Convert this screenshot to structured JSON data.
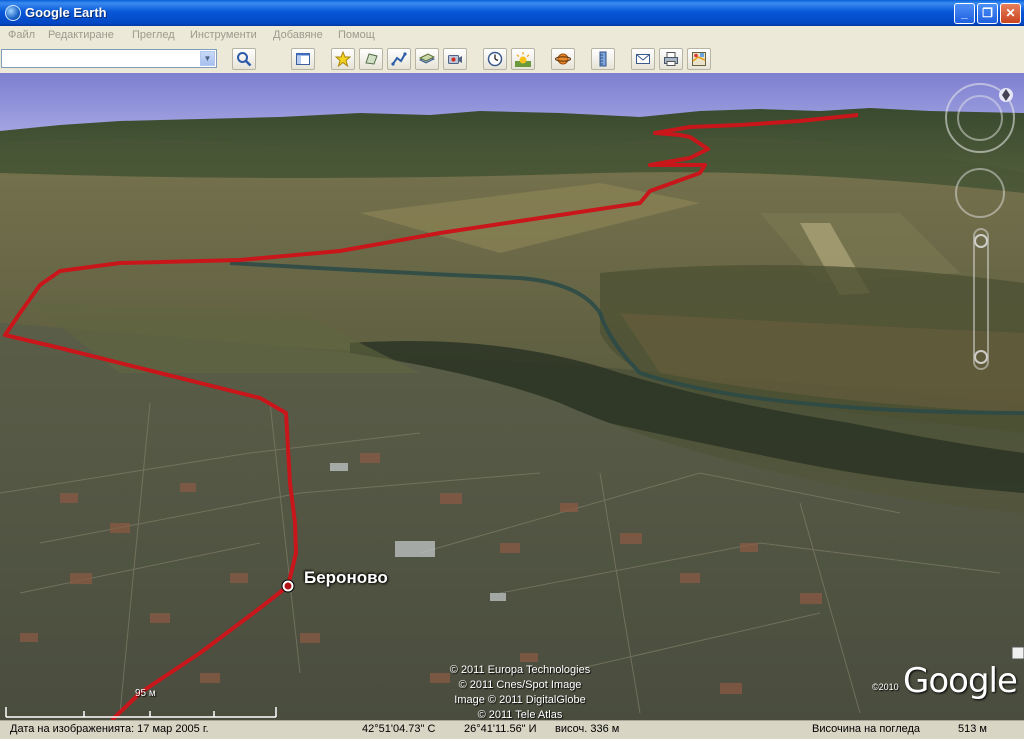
{
  "window": {
    "title": "Google Earth"
  },
  "menu": [
    "Файл",
    "Редактиране",
    "Преглед",
    "Инструменти",
    "Добавяне",
    "Помощ"
  ],
  "search": {
    "value": "",
    "placeholder": ""
  },
  "map": {
    "place_label": "Бероново",
    "attribution": [
      "© 2011 Europa Technologies",
      "© 2011 Cnes/Spot Image",
      "Image © 2011 DigitalGlobe",
      "© 2011 Tele Atlas"
    ],
    "scale_label": "95 м",
    "logo_year": "©2010",
    "logo_text": "Google"
  },
  "status": {
    "image_date": "Дата на изображенията: 17 мар 2005 г.",
    "latitude": "42°51'04.73\" С",
    "longitude": "26°41'11.56\" И",
    "elevation": "височ.  336 м",
    "eye_alt_label": "Височина на погледа",
    "eye_alt_value": "513 м"
  },
  "colors": {
    "route": "#c8161b",
    "titlebar": "#0858d8",
    "river": "#2a4a48"
  },
  "icons": [
    "search-icon",
    "sidebar-icon",
    "placemark-icon",
    "polygon-icon",
    "path-icon",
    "overlay-icon",
    "record-tour-icon",
    "historical-imagery-icon",
    "sunlight-icon",
    "planet-icon",
    "ruler-icon",
    "email-icon",
    "print-icon",
    "google-maps-icon"
  ]
}
